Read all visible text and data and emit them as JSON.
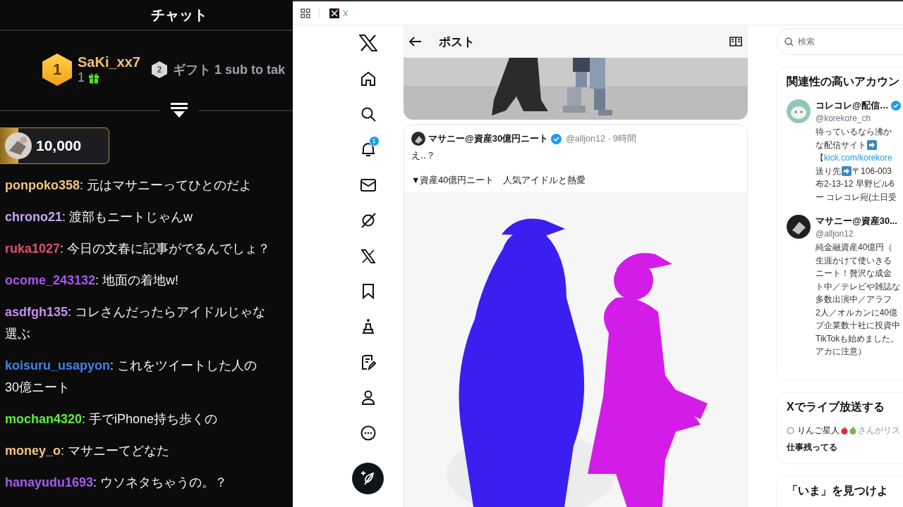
{
  "chat": {
    "title": "チャット",
    "top_gifter": {
      "rank": "1",
      "name": "SaKi_xx7",
      "count": "1"
    },
    "next_entry": {
      "rank": "2",
      "text": "ギフト 1 sub to tak"
    },
    "pinned_amount": "10,000",
    "messages": [
      {
        "user": "ponpoko358",
        "color": "#f3c27e",
        "text": ": 元はマサニーってひとのだよ"
      },
      {
        "user": "chrono21",
        "color": "#c9a6f4",
        "text": ": 渡部もニートじゃんw"
      },
      {
        "user": "ruka1027",
        "color": "#e2506c",
        "text": ": 今日の文春に記事がでるんでしょ？"
      },
      {
        "user": "ocome_243132",
        "color": "#a855f0",
        "text": ": 地面の着地w!"
      },
      {
        "user": "asdfgh135",
        "color": "#c88cf0",
        "text": ": コレさんだったらアイドルじゃな",
        "text_line_2": "選ぶ"
      },
      {
        "user": "koisuru_usapyon",
        "color": "#3d82f0",
        "text": ": これをツイートした人の",
        "text_line_2": "30億ニート"
      },
      {
        "user": "mochan4320",
        "color": "#5ef03c",
        "text": ": 手でiPhone持ち歩くの"
      },
      {
        "user": "money_o",
        "color": "#f6c27c",
        "text": ": マサニーてどなた"
      },
      {
        "user": "hanayudu1693",
        "color": "#a35bf0",
        "text": ": ウソネタちゃうの。？"
      }
    ]
  },
  "browser": {
    "tab_title": "X"
  },
  "nav": {
    "notification_count": "1"
  },
  "post": {
    "title": "ポスト",
    "quote": {
      "author": "マサニー@資産30億円ニート",
      "verified": true,
      "handle_time": "@alljon12 · 9時間",
      "lines": [
        "え‥？",
        "▼資産40億円ニート　人気アイドルと熱愛"
      ]
    }
  },
  "sidebar": {
    "search": {
      "placeholder": "検索"
    },
    "related": {
      "title": "関連性の高いアカウン",
      "accounts": [
        {
          "name": "コレコレ@配信…",
          "verified": true,
          "handle": "@korekore_ch",
          "bio": [
            [
              {
                "kind": "text",
                "text": "待っているなら沸か"
              }
            ],
            [
              {
                "kind": "text",
                "text": "な配信サイト"
              },
              {
                "kind": "arrow"
              }
            ],
            [
              {
                "kind": "text",
                "text": "【"
              },
              {
                "kind": "link",
                "text": "kick.com/korekore"
              }
            ],
            [
              {
                "kind": "text",
                "text": "送り先"
              },
              {
                "kind": "arrow"
              },
              {
                "kind": "text",
                "text": " 〒106-003"
              }
            ],
            [
              {
                "kind": "text",
                "text": "布2-13-12 早野ビル6"
              }
            ],
            [
              {
                "kind": "text",
                "text": "ー コレコレ宛(土日受"
              }
            ]
          ]
        },
        {
          "name": "マサニー@資産30...",
          "handle": "@alljon12",
          "bio": [
            [
              {
                "kind": "text",
                "text": "純金融資産40億円（"
              }
            ],
            [
              {
                "kind": "text",
                "text": "生涯かけて使いきる"
              }
            ],
            [
              {
                "kind": "text",
                "text": "ニート！贅沢な成金"
              }
            ],
            [
              {
                "kind": "text",
                "text": "ト中／テレビや雑誌な"
              }
            ],
            [
              {
                "kind": "text",
                "text": "多数出演中／アラフ"
              }
            ],
            [
              {
                "kind": "text",
                "text": "2人／オルカンに40億"
              }
            ],
            [
              {
                "kind": "text",
                "text": "プ企業数十社に投資中"
              }
            ],
            [
              {
                "kind": "text",
                "text": "TikTokも始めました。"
              }
            ],
            [
              {
                "kind": "text",
                "text": "アカに注意）"
              }
            ]
          ]
        }
      ]
    },
    "live": {
      "title": "Xでライブ放送する",
      "host": "りんご星人",
      "suffix": "さんがリス",
      "topic": "仕事残ってる"
    },
    "explore": {
      "title": "「いま」を見つけよ"
    }
  }
}
